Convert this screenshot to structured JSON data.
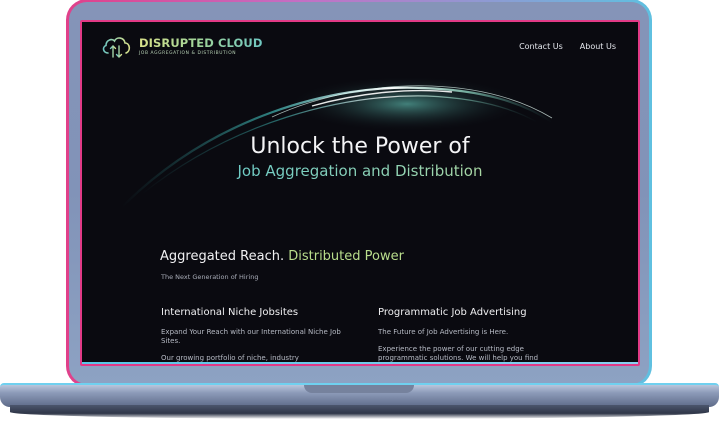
{
  "brand": {
    "name": "DISRUPTED CLOUD",
    "tagline": "JOB AGGREGATION & DISTRIBUTION"
  },
  "nav": {
    "items": [
      {
        "label": "Contact Us"
      },
      {
        "label": "About Us"
      }
    ]
  },
  "hero": {
    "line1": "Unlock the Power of",
    "line2": "Job Aggregation and Distribution"
  },
  "section": {
    "title_main": "Aggregated Reach.",
    "title_accent": "Distributed Power",
    "subtitle": "The Next Generation of Hiring"
  },
  "columns": [
    {
      "heading": "International Niche Jobsites",
      "paragraphs": [
        "Expand Your Reach with our International Niche Job Sites.",
        "Our growing portfolio of niche, industry"
      ]
    },
    {
      "heading": "Programmatic Job Advertising",
      "paragraphs": [
        "The Future of Job Advertising is Here.",
        "Experience the power of our cutting edge programmatic solutions. We will help you find"
      ]
    }
  ],
  "colors": {
    "frame_glow_pink": "#e23a86",
    "frame_glow_cyan": "#59c7e6",
    "screen_bg": "#0a0a10",
    "accent_green": "#b9dd8c",
    "accent_teal": "#4fc6d8"
  }
}
